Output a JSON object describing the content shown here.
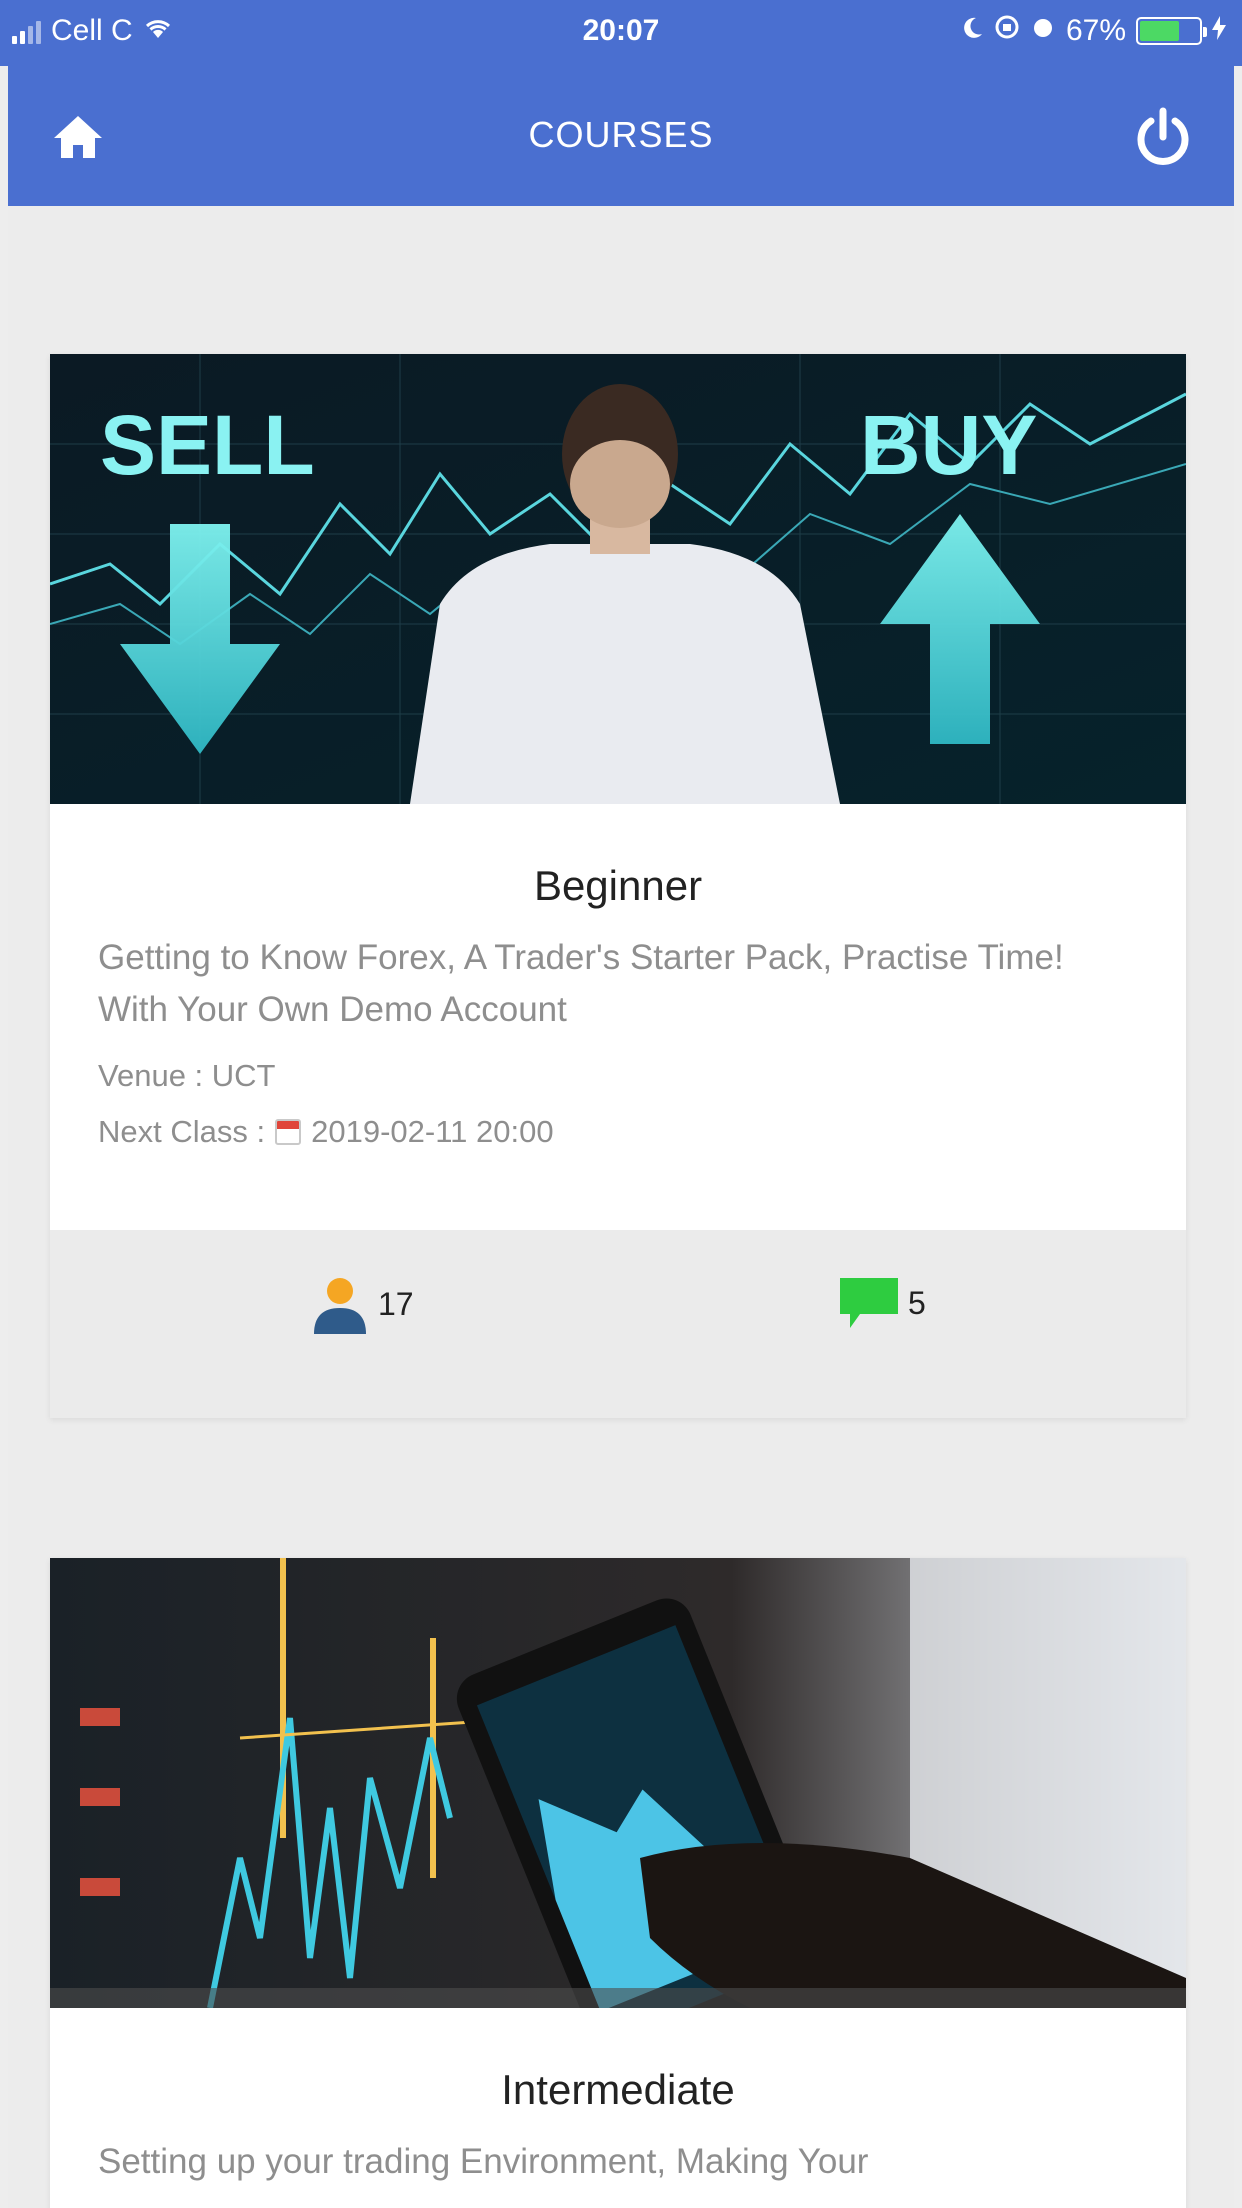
{
  "status_bar": {
    "carrier": "Cell C",
    "time": "20:07",
    "battery_percent": "67%",
    "battery_level": 0.67,
    "icons": [
      "signal-icon",
      "wifi-icon",
      "moon-icon",
      "orientation-lock-icon",
      "alarm-icon",
      "battery-icon",
      "charging-icon"
    ]
  },
  "header": {
    "title": "COURSES",
    "left_icon": "home-icon",
    "right_icon": "power-icon"
  },
  "colors": {
    "primary": "#4a6fd0",
    "background": "#ececec",
    "user_icon_top": "#f5a623",
    "user_icon_bottom": "#2f5b8a",
    "comment_icon": "#2ecc40"
  },
  "courses": [
    {
      "image_text_left": "SELL",
      "image_text_right": "BUY",
      "title": "Beginner",
      "description": "Getting to Know Forex, A Trader's Starter Pack, Practise Time! With Your Own Demo Account",
      "venue": "Venue : UCT",
      "next_class_label": "Next Class :",
      "next_class_date": "2019-02-11 20:00",
      "students": "17",
      "comments": "5"
    },
    {
      "title": "Intermediate",
      "description": "Setting up your trading Environment, Making Your"
    }
  ]
}
